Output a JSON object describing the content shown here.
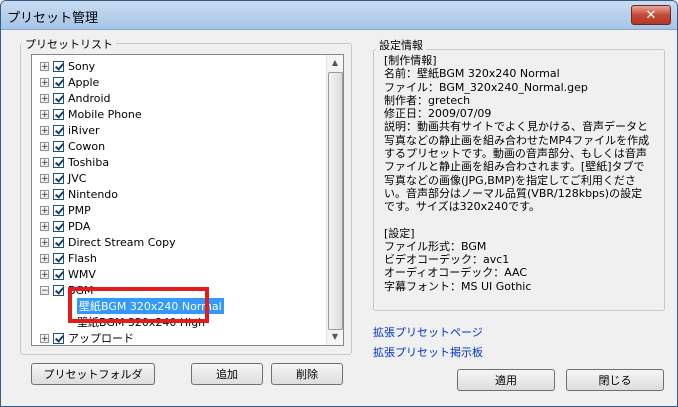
{
  "window": {
    "title": "プリセット管理",
    "close_symbol": "✕"
  },
  "preset_list": {
    "label": "プリセットリスト",
    "items": [
      {
        "label": "Sony",
        "expander": "+"
      },
      {
        "label": "Apple",
        "expander": "+"
      },
      {
        "label": "Android",
        "expander": "+"
      },
      {
        "label": "Mobile Phone",
        "expander": "+"
      },
      {
        "label": "iRiver",
        "expander": "+"
      },
      {
        "label": "Cowon",
        "expander": "+"
      },
      {
        "label": "Toshiba",
        "expander": "+"
      },
      {
        "label": "JVC",
        "expander": "+"
      },
      {
        "label": "Nintendo",
        "expander": "+"
      },
      {
        "label": "PMP",
        "expander": "+"
      },
      {
        "label": "PDA",
        "expander": "+"
      },
      {
        "label": "Direct Stream Copy",
        "expander": "+"
      },
      {
        "label": "Flash",
        "expander": "+"
      },
      {
        "label": "WMV",
        "expander": "+"
      },
      {
        "label": "BGM",
        "expander": "−"
      },
      {
        "label": "壁紙BGM 320x240 Normal",
        "leaf": true,
        "selected": true
      },
      {
        "label": "壁紙BGM 320x240 High",
        "leaf": true
      },
      {
        "label": "アップロード",
        "expander": "+"
      }
    ]
  },
  "buttons": {
    "preset_folder": "プリセットフォルダ",
    "add": "追加",
    "delete": "削除",
    "apply": "適用",
    "close": "閉じる"
  },
  "settings_info": {
    "label": "設定情報",
    "lines": [
      "[制作情報]",
      "名前：壁紙BGM 320x240 Normal",
      "ファイル：BGM_320x240_Normal.gep",
      "制作者：gretech",
      "修正日：2009/07/09",
      "説明：動画共有サイトでよく見かける、音声データと写真などの静止画を組み合わせたMP4ファイルを作成するプリセットです。動画の音声部分、もしくは音声ファイルと静止画を組み合わされます。[壁紙]タブで写真などの画像(JPG,BMP)を指定してご利用ください。音声部分はノーマル品質(VBR/128kbps)の設定です。サイズは320x240です。",
      "",
      "[設定]",
      "ファイル形式：BGM",
      "ビデオコーデック：avc1",
      "オーディオコーデック：AAC",
      "字幕フォント：MS UI Gothic"
    ]
  },
  "links": {
    "extension_page": "拡張プリセットページ",
    "bulletin_board": "拡張プリセット掲示板"
  },
  "scrollbar": {
    "up": "▲",
    "down": "▼"
  }
}
